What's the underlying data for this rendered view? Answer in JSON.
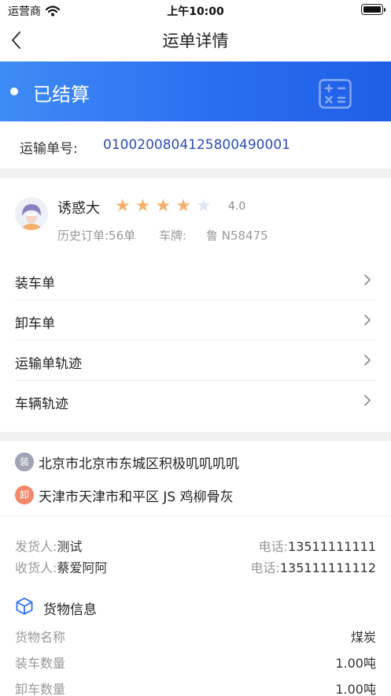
{
  "status_bar": {
    "carrier": "运营商",
    "time": "上午10:00"
  },
  "nav": {
    "title": "运单详情"
  },
  "banner": {
    "status": "已结算"
  },
  "order": {
    "label": "运输单号:",
    "number": "010020080412580049 0001"
  },
  "driver": {
    "name": "诱惑大",
    "rating": "4.0",
    "stars_filled": 4,
    "stars_total": 5,
    "history": "历史订单:56单",
    "plate_label": "车牌:",
    "plate": "鲁 N58475"
  },
  "menu": [
    {
      "label": "装车单"
    },
    {
      "label": "卸车单"
    },
    {
      "label": "运输单轨迹"
    },
    {
      "label": "车辆轨迹"
    }
  ],
  "addresses": {
    "load": {
      "badge": "装",
      "text": "北京市北京市东城区积极叽叽叽叽"
    },
    "unload": {
      "badge": "卸",
      "text": "天津市天津市和平区 JS 鸡柳骨灰"
    }
  },
  "contacts": {
    "sender": {
      "label": "发货人:",
      "name": "测试",
      "phone_label": "电话:",
      "phone": "13511111111"
    },
    "receiver": {
      "label": "收货人:",
      "name": "蔡爱阿阿",
      "phone_label": "电话:",
      "phone": "135111111112"
    }
  },
  "goods": {
    "title": "货物信息",
    "rows": [
      {
        "label": "货物名称",
        "value": "煤炭"
      },
      {
        "label": "装车数量",
        "value": "1.00吨"
      },
      {
        "label": "卸车数量",
        "value": "1.00吨"
      }
    ]
  },
  "colors": {
    "accent": "#2a6ef0",
    "order_number": "#2e4db0",
    "star_on": "#f5b06b",
    "star_off": "#dfe5f2",
    "badge_load": "#9fa3b3",
    "badge_unload": "#f2886b"
  }
}
